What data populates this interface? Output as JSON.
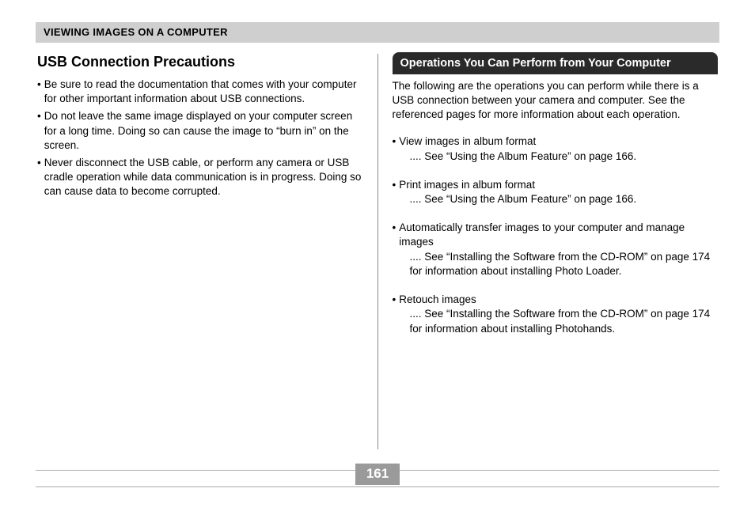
{
  "header": "VIEWING IMAGES ON A COMPUTER",
  "left": {
    "title": "USB Connection Precautions",
    "bullets": [
      "Be sure to read the documentation that comes with your computer for other important information about USB connections.",
      "Do not leave the same image displayed on your computer screen for a long time. Doing so can cause the image to “burn in” on the screen.",
      "Never disconnect the USB cable, or perform any camera or USB cradle operation while data communication is in progress. Doing so can cause data to become corrupted."
    ]
  },
  "right": {
    "heading": "Operations You Can Perform from Your Computer",
    "intro": "The following are the operations you can perform while there is a USB connection between your camera and computer. See the referenced pages for more information about each operation.",
    "operations": [
      {
        "title": "View images in album format",
        "ref": ".... See “Using the Album Feature” on page 166."
      },
      {
        "title": "Print images in album format",
        "ref": ".... See “Using the Album Feature” on page 166."
      },
      {
        "title": "Automatically transfer images to your computer and manage images",
        "ref": ".... See “Installing the Software from the CD-ROM” on page 174 for information about installing Photo Loader."
      },
      {
        "title": "Retouch images",
        "ref": ".... See “Installing the Software from the CD-ROM” on page 174 for information about installing Photohands."
      }
    ]
  },
  "page_number": "161"
}
